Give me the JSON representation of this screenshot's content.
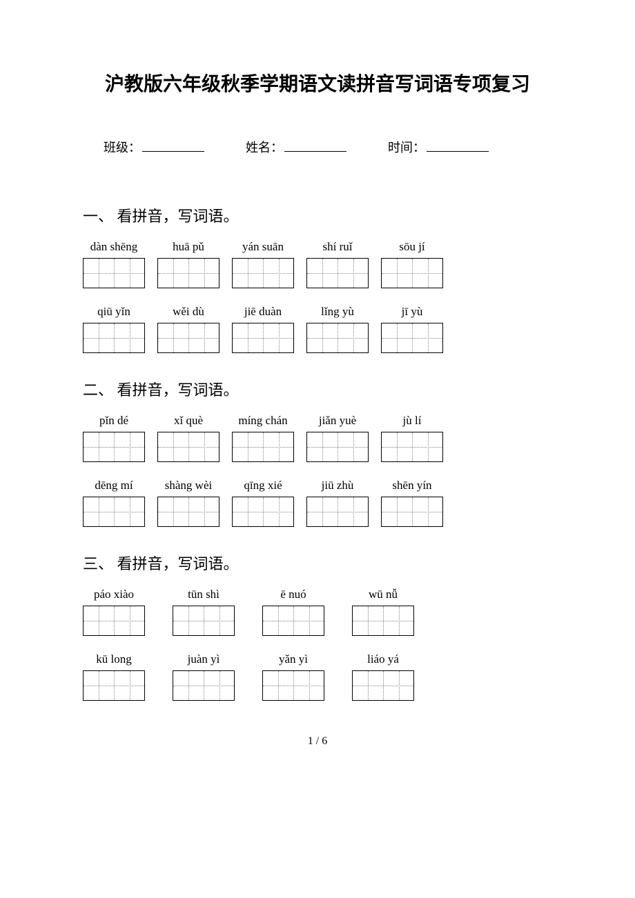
{
  "title": "沪教版六年级秋季学期语文读拼音写词语专项复习",
  "info": {
    "class_label": "班级：",
    "name_label": "姓名：",
    "time_label": "时间："
  },
  "sections": [
    {
      "heading": "一、 看拼音，写词语。",
      "rows": [
        {
          "items": [
            {
              "pinyin": "dàn shēng"
            },
            {
              "pinyin": "huā pǔ"
            },
            {
              "pinyin": "yán suān"
            },
            {
              "pinyin": "shí ruǐ"
            },
            {
              "pinyin": "sōu jí"
            }
          ]
        },
        {
          "items": [
            {
              "pinyin": "qiū yǐn"
            },
            {
              "pinyin": "wěi dù"
            },
            {
              "pinyin": "jiē duàn"
            },
            {
              "pinyin": "lǐng yù"
            },
            {
              "pinyin": "jī yù"
            }
          ]
        }
      ]
    },
    {
      "heading": "二、 看拼音，写词语。",
      "rows": [
        {
          "items": [
            {
              "pinyin": "pǐn dé"
            },
            {
              "pinyin": "xǐ què"
            },
            {
              "pinyin": "míng chán"
            },
            {
              "pinyin": "jiǎn yuè"
            },
            {
              "pinyin": "jù lí"
            }
          ]
        },
        {
          "items": [
            {
              "pinyin": "dēng mí"
            },
            {
              "pinyin": "shàng wèi"
            },
            {
              "pinyin": "qīng xié"
            },
            {
              "pinyin": "jiū zhù"
            },
            {
              "pinyin": "shēn yín"
            }
          ]
        }
      ]
    },
    {
      "heading": "三、 看拼音，写词语。",
      "rows": [
        {
          "gap": 40,
          "items": [
            {
              "pinyin": "páo xiào"
            },
            {
              "pinyin": "tūn shì"
            },
            {
              "pinyin": "ē nuó"
            },
            {
              "pinyin": "wū nǚ"
            }
          ]
        },
        {
          "gap": 40,
          "items": [
            {
              "pinyin": "kū long"
            },
            {
              "pinyin": "juàn yì"
            },
            {
              "pinyin": "yǎn yì"
            },
            {
              "pinyin": "liáo yá"
            }
          ]
        }
      ]
    }
  ],
  "page_number": "1 / 6"
}
